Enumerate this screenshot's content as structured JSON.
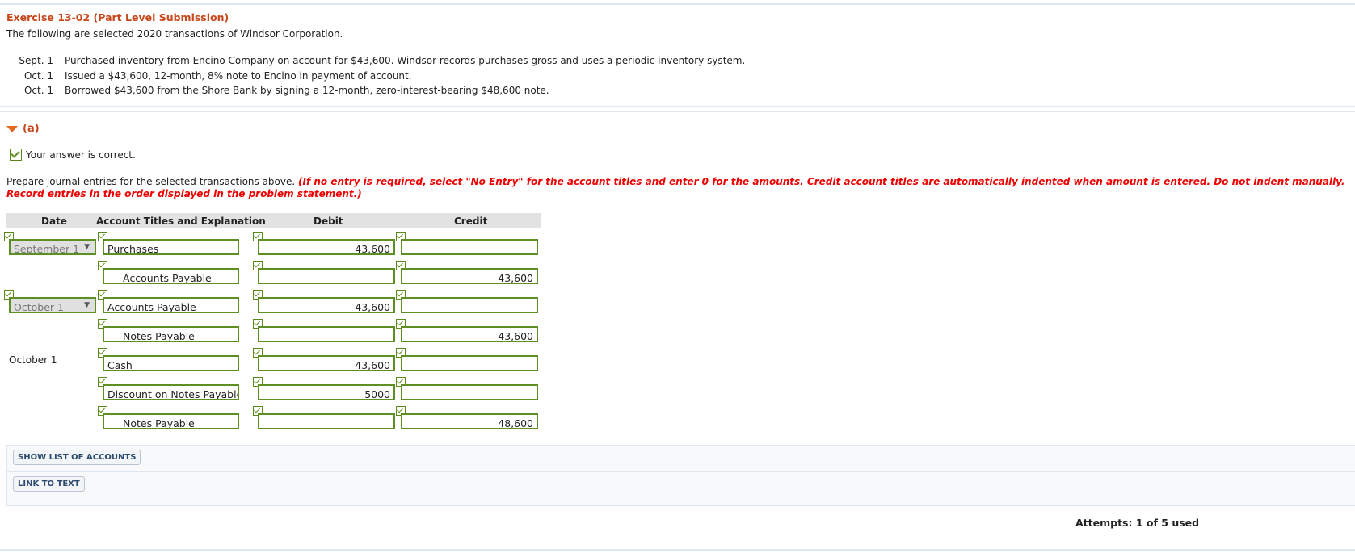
{
  "exercise": {
    "title": "Exercise 13-02 (Part Level Submission)",
    "intro": "The following are selected 2020 transactions of Windsor Corporation."
  },
  "transactions": [
    {
      "date": "Sept. 1",
      "text": "Purchased inventory from Encino Company on account for $43,600. Windsor records purchases gross and uses a periodic inventory system."
    },
    {
      "date": "Oct. 1",
      "text": "Issued a $43,600, 12-month, 8% note to Encino in payment of account."
    },
    {
      "date": "Oct. 1",
      "text": "Borrowed $43,600 from the Shore Bank by signing a 12-month, zero-interest-bearing $48,600 note."
    }
  ],
  "part": {
    "label": "(a)",
    "status": "Your answer is correct.",
    "instruction": "Prepare journal entries for the selected transactions above.",
    "instruction_note": "(If no entry is required, select \"No Entry\" for the account titles and enter 0 for the amounts. Credit account titles are automatically indented when amount is entered. Do not indent manually. Record entries in the order displayed in the problem statement.)"
  },
  "table": {
    "headers": {
      "date": "Date",
      "account": "Account Titles and Explanation",
      "debit": "Debit",
      "credit": "Credit"
    },
    "rows": [
      {
        "date": "September 1",
        "account": "Purchases",
        "debit": "43,600",
        "credit": ""
      },
      {
        "date": "",
        "account": "Accounts Payable",
        "debit": "",
        "credit": "43,600"
      },
      {
        "date": "October 1",
        "account": "Accounts Payable",
        "debit": "43,600",
        "credit": ""
      },
      {
        "date": "",
        "account": "Notes Payable",
        "debit": "",
        "credit": "43,600"
      },
      {
        "date": "October 1",
        "account": "Cash",
        "debit": "43,600",
        "credit": ""
      },
      {
        "date": "",
        "account": "Discount on Notes Payable",
        "debit": "5000",
        "credit": ""
      },
      {
        "date": "",
        "account": "Notes Payable",
        "debit": "",
        "credit": "48,600"
      }
    ]
  },
  "buttons": {
    "show_accounts": "SHOW LIST OF ACCOUNTS",
    "link_text": "LINK TO TEXT"
  },
  "attempts": "Attempts: 1 of 5 used",
  "colors": {
    "accent": "#c8471b",
    "field_border": "#5e8f23",
    "warning": "#e00000"
  }
}
